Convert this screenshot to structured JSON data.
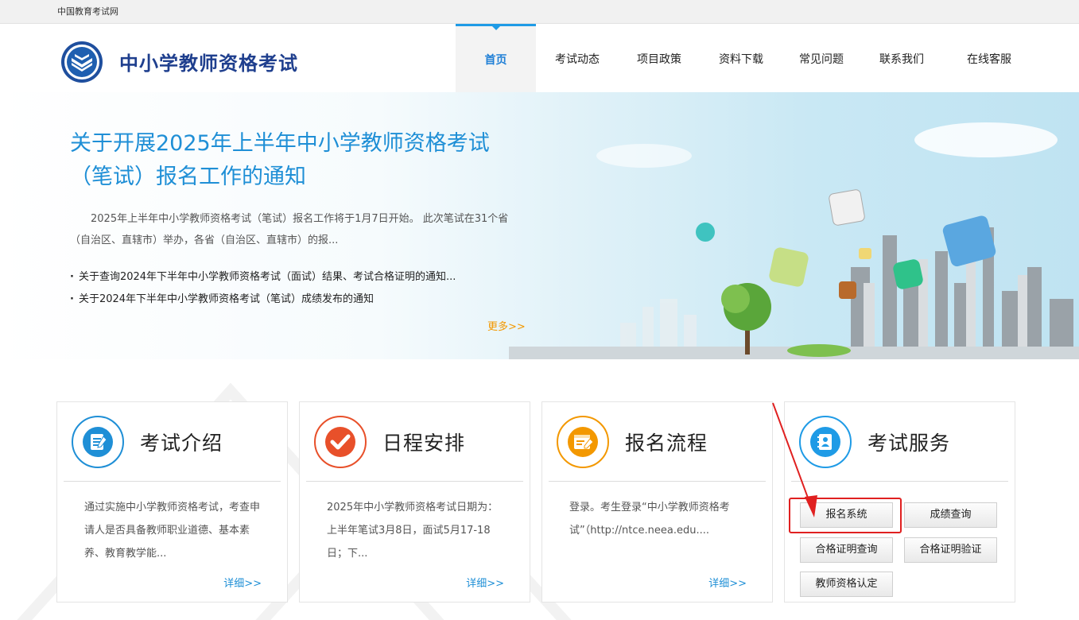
{
  "topbar": {
    "site_name": "中国教育考试网"
  },
  "header": {
    "brand": "中小学教师资格考试",
    "nav": [
      "首页",
      "考试动态",
      "项目政策",
      "资料下载",
      "常见问题",
      "联系我们",
      "在线客服"
    ],
    "active_nav": "首页"
  },
  "hero": {
    "title": "关于开展2025年上半年中小学教师资格考试（笔试）报名工作的通知",
    "description": "2025年上半年中小学教师资格考试（笔试）报名工作将于1月7日开始。 此次笔试在31个省（自治区、直辖市）举办，各省（自治区、直辖市）的报...",
    "news": [
      "关于查询2024年下半年中小学教师资格考试（面试）结果、考试合格证明的通知...",
      "关于2024年下半年中小学教师资格考试（笔试）成绩发布的通知"
    ],
    "more": "更多>>"
  },
  "cards": [
    {
      "title": "考试介绍",
      "icon": "document-edit-icon",
      "accent": "#1f8fd6",
      "body": "通过实施中小学教师资格考试，考查申请人是否具备教师职业道德、基本素养、教育教学能...",
      "more": "详细>>"
    },
    {
      "title": "日程安排",
      "icon": "checkmark-icon",
      "accent": "#e8502a",
      "body": "2025年中小学教师资格考试日期为：上半年笔试3月8日，面试5月17-18日；下...",
      "more": "详细>>"
    },
    {
      "title": "报名流程",
      "icon": "registration-form-icon",
      "accent": "#f39800",
      "body": "登录。考生登录“中小学教师资格考试”（http://ntce.neea.edu....",
      "more": "详细>>"
    },
    {
      "title": "考试服务",
      "icon": "address-book-icon",
      "accent": "#1f9be6"
    }
  ],
  "services": [
    "报名系统",
    "成绩查询",
    "合格证明查询",
    "合格证明验证",
    "教师资格认定"
  ],
  "colors": {
    "brand_blue": "#1f3f8e",
    "link_blue": "#1f8fd6",
    "more_orange": "#f39800",
    "highlight_red": "#e02020"
  }
}
